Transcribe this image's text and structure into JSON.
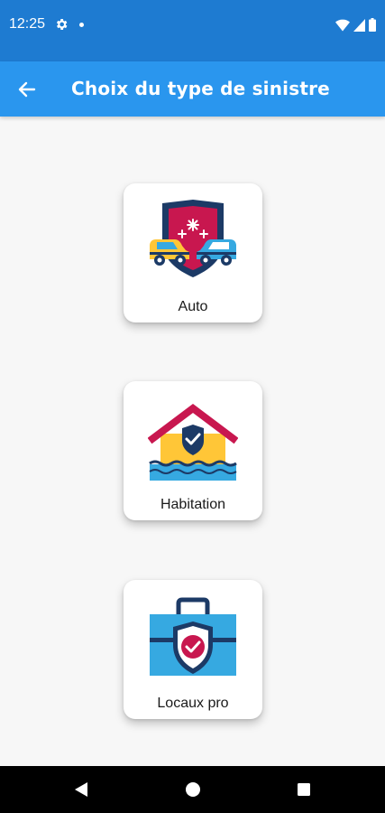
{
  "status_bar": {
    "time": "12:25",
    "icons": [
      "gear-icon",
      "notification-dot-icon",
      "wifi-icon",
      "signal-icon",
      "battery-icon"
    ]
  },
  "app_bar": {
    "title": "Choix du type de sinistre",
    "back_icon": "arrow-left-icon",
    "background_color": "#2a96ee"
  },
  "claim_types": [
    {
      "label": "Auto",
      "icon": "car-collision-shield-icon"
    },
    {
      "label": "Habitation",
      "icon": "house-flood-icon"
    },
    {
      "label": "Locaux pro",
      "icon": "briefcase-shield-icon"
    }
  ],
  "nav_bar": {
    "buttons": [
      "back-triangle-icon",
      "home-circle-icon",
      "recents-square-icon"
    ]
  },
  "colors": {
    "status_bar": "#1e7bd1",
    "accent": "#2a96ee",
    "shield_navy": "#1c3a66",
    "crimson": "#c8174f",
    "yellow": "#ffc637",
    "sky": "#36a9e1"
  }
}
